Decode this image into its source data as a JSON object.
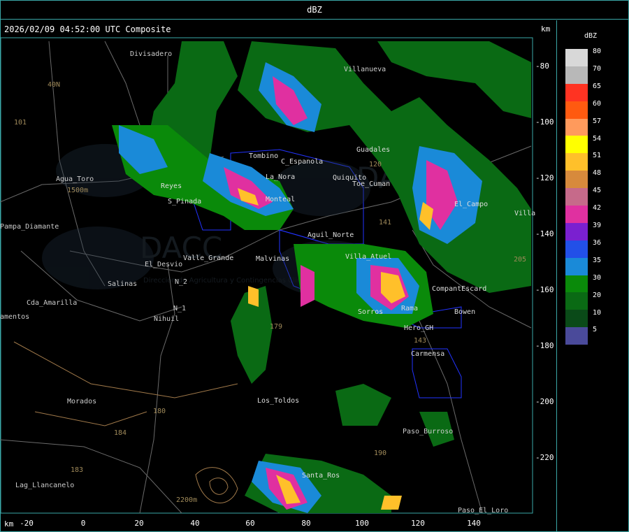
{
  "header": {
    "title": "dBZ"
  },
  "plot": {
    "datetime": "2026/02/09 04:52:00 UTC Composite",
    "unit_right": "km",
    "unit_bottom": "km",
    "y_ticks": [
      "-80",
      "-100",
      "-120",
      "-140",
      "-160",
      "-180",
      "-200",
      "-220"
    ],
    "x_ticks": [
      "-20",
      "0",
      "20",
      "40",
      "60",
      "80",
      "100",
      "120",
      "140"
    ]
  },
  "places": [
    "Divisadero",
    "Villanueva",
    "40N",
    "101",
    "Agua_Toro",
    "1500m",
    "Pampa_Diamante",
    "El_Desvio",
    "Salinas",
    "Cda_Amarilla",
    "amentos",
    "Nihuil",
    "N_1",
    "N_2",
    "Morados",
    "Lag_Llancanelo",
    "184",
    "183",
    "180",
    "2200m",
    "Valle_Grande",
    "S_Pinada",
    "Reyes",
    "Tombino",
    "C_Espanola",
    "La_Nora",
    "Guadales",
    "Quiquito",
    "Toe_Cuman",
    "El_Campo",
    "Villa",
    "120",
    "Monteal",
    "Rama",
    "Sorros",
    "CompantEscard",
    "Bowen",
    "Hero_GH",
    "Carmensa",
    "Paso_Burroso",
    "Paso_El_Loro",
    "Los_Toldos",
    "Malvinas",
    "179",
    "143",
    "Aguil_Norte",
    "141",
    "Villa_Atuel",
    "205",
    "190",
    "Santa_Ros"
  ],
  "legend": {
    "title": "dBZ",
    "labels": [
      "80",
      "70",
      "65",
      "60",
      "57",
      "54",
      "51",
      "48",
      "45",
      "42",
      "39",
      "36",
      "35",
      "30",
      "20",
      "10",
      "5"
    ],
    "colors": [
      "#d8d8d8",
      "#b8b8b8",
      "#ff3322",
      "#ff5a10",
      "#ff9a5c",
      "#ffff00",
      "#ffc02a",
      "#d78a3c",
      "#c66a8a",
      "#e030a0",
      "#7a20d0",
      "#2250e8",
      "#1a8ad8",
      "#0a8a0a",
      "#0a6a14",
      "#0a4a18",
      "#4a4a9a"
    ]
  },
  "watermark": {
    "text1": "DACC",
    "text2": "Dirección de Agricultura y Contingencias Climáticas"
  }
}
